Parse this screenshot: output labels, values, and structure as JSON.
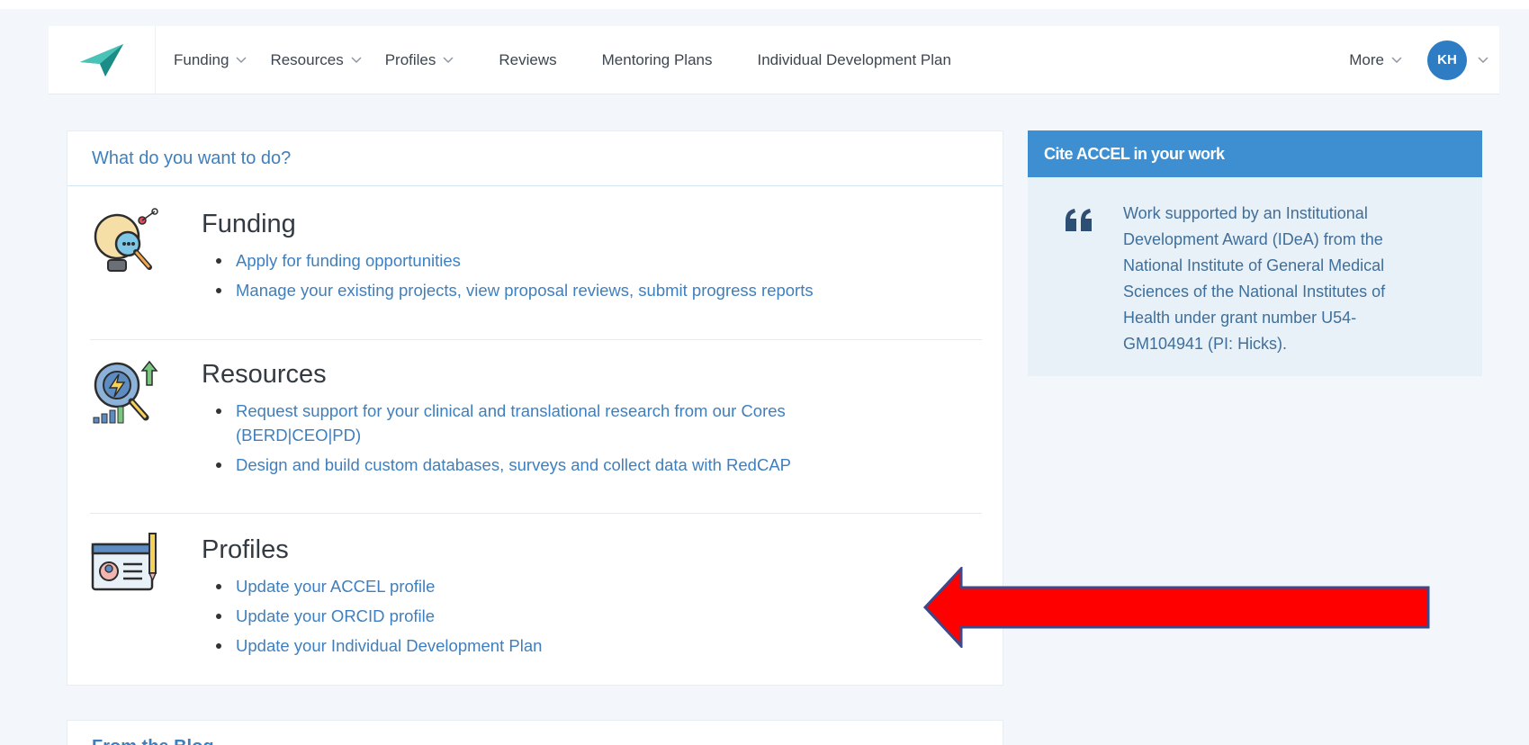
{
  "nav": {
    "items": [
      {
        "label": "Funding",
        "dropdown": true
      },
      {
        "label": "Resources",
        "dropdown": true
      },
      {
        "label": "Profiles",
        "dropdown": true
      },
      {
        "label": "Reviews",
        "dropdown": false
      },
      {
        "label": "Mentoring Plans",
        "dropdown": false
      },
      {
        "label": "Individual Development Plan",
        "dropdown": false
      }
    ],
    "more_label": "More",
    "avatar_initials": "KH"
  },
  "main": {
    "heading": "What do you want to do?",
    "sections": [
      {
        "title": "Funding",
        "icon": "lightbulb-magnifier-icon",
        "links": [
          "Apply for funding opportunities",
          "Manage your existing projects, view proposal reviews, submit progress reports"
        ]
      },
      {
        "title": "Resources",
        "icon": "analytics-magnifier-icon",
        "links": [
          "Request support for your clinical and translational research from our Cores (BERD|CEO|PD)",
          "Design and build custom databases, surveys and collect data with RedCAP"
        ]
      },
      {
        "title": "Profiles",
        "icon": "profile-card-icon",
        "links": [
          "Update your ACCEL profile",
          "Update your ORCID profile",
          "Update your Individual Development Plan"
        ]
      }
    ]
  },
  "cite": {
    "heading": "Cite ACCEL in your work",
    "text": "Work supported by an Institutional Development Award (IDeA) from the National Institute of General Medical Sciences of the National Institutes of Health under grant number U54-GM104941 (PI: Hicks)."
  },
  "blog": {
    "heading": "From the Blog"
  },
  "colors": {
    "accent": "#3f7fbd",
    "cite_header": "#3d8fd1",
    "avatar": "#2d7cc4",
    "annotation_arrow": "#ff0000"
  }
}
